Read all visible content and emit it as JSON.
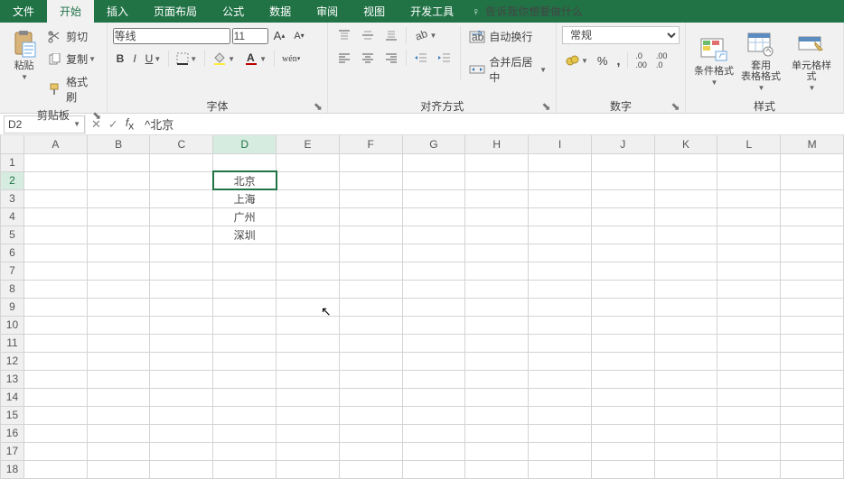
{
  "tabs": {
    "file": "文件",
    "home": "开始",
    "insert": "插入",
    "layout": "页面布局",
    "formulas": "公式",
    "data": "数据",
    "review": "审阅",
    "view": "视图",
    "dev": "开发工具"
  },
  "tell_me": "告诉我你想要做什么",
  "clipboard": {
    "paste": "粘贴",
    "cut": "剪切",
    "copy": "复制",
    "painter": "格式刷",
    "label": "剪贴板"
  },
  "font": {
    "name": "等线",
    "size": "11",
    "label": "字体"
  },
  "align": {
    "wrap": "自动换行",
    "merge": "合并后居中",
    "label": "对齐方式"
  },
  "number": {
    "format": "常规",
    "label": "数字"
  },
  "styles": {
    "cond": "条件格式",
    "table": "套用\n表格格式",
    "cell": "单元格样式",
    "label": "样式"
  },
  "namebox": "D2",
  "formula": "^北京",
  "columns": [
    "A",
    "B",
    "C",
    "D",
    "E",
    "F",
    "G",
    "H",
    "I",
    "J",
    "K",
    "L",
    "M"
  ],
  "rows": 18,
  "cells": {
    "D2": "北京",
    "D3": "上海",
    "D4": "广州",
    "D5": "深圳"
  },
  "selected": {
    "col": "D",
    "row": 2
  }
}
